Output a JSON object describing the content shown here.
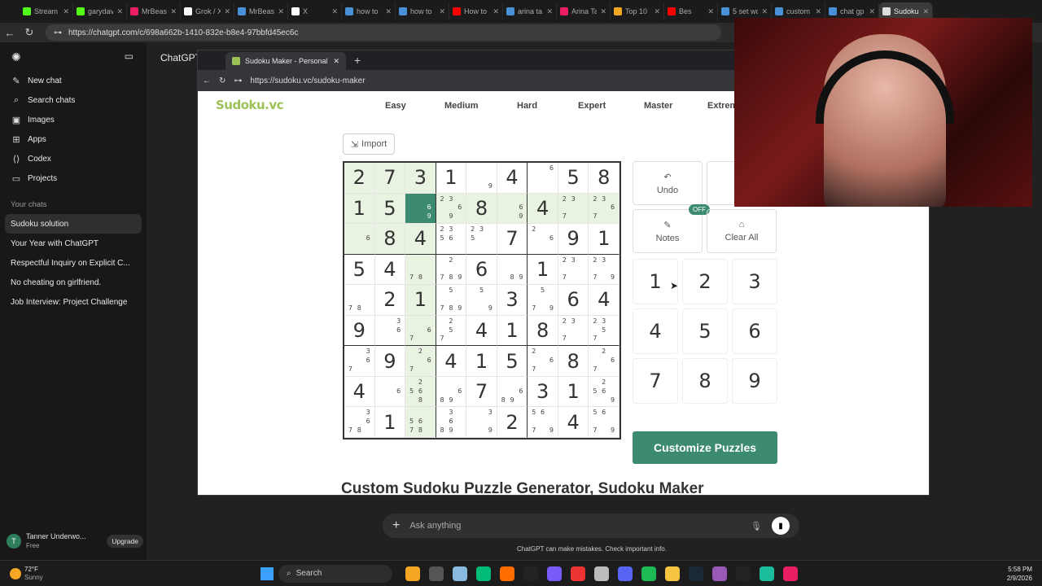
{
  "outer_browser": {
    "tabs": [
      {
        "label": "Stream",
        "color": "#53fc18"
      },
      {
        "label": "garydav",
        "color": "#53fc18"
      },
      {
        "label": "MrBeast",
        "color": "#e91e63"
      },
      {
        "label": "Grok / X",
        "color": "#ffffff"
      },
      {
        "label": "MrBeast",
        "color": "#4a90d9"
      },
      {
        "label": "X",
        "color": "#ffffff"
      },
      {
        "label": "how to",
        "color": "#4a90d9"
      },
      {
        "label": "how to",
        "color": "#4a90d9"
      },
      {
        "label": "How to",
        "color": "#ff0000"
      },
      {
        "label": "arina ta",
        "color": "#4a90d9"
      },
      {
        "label": "Arina Ta",
        "color": "#e91e63"
      },
      {
        "label": "Top 10",
        "color": "#f5a623"
      },
      {
        "label": "Bes",
        "color": "#ff0000"
      },
      {
        "label": "5 set wo",
        "color": "#4a90d9"
      },
      {
        "label": "custom",
        "color": "#4a90d9"
      },
      {
        "label": "chat gp",
        "color": "#4a90d9"
      },
      {
        "label": "Sudoku",
        "color": "#dddddd"
      }
    ],
    "url": "https://chatgpt.com/c/698a662b-1410-832e-b8e4-97bbfd45ec6c"
  },
  "chatgpt": {
    "header_title": "ChatGPT",
    "nav": [
      {
        "label": "New chat",
        "icon": "pencil-icon"
      },
      {
        "label": "Search chats",
        "icon": "search-icon"
      },
      {
        "label": "Images",
        "icon": "image-icon"
      },
      {
        "label": "Apps",
        "icon": "apps-icon"
      },
      {
        "label": "Codex",
        "icon": "code-icon"
      },
      {
        "label": "Projects",
        "icon": "folder-icon"
      }
    ],
    "chats_heading": "Your chats",
    "chats": [
      "Sudoku solution",
      "Your Year with ChatGPT",
      "Respectful Inquiry on Explicit C...",
      "No cheating on girlfriend.",
      "Job Interview: Project Challenge"
    ],
    "user_name": "Tanner Underwo...",
    "user_plan": "Free",
    "user_initial": "T",
    "upgrade_label": "Upgrade",
    "composer_placeholder": "Ask anything",
    "disclaimer": "ChatGPT can make mistakes. Check important info."
  },
  "inner_browser": {
    "tab_title": "Sudoku Maker - Personalized Puzz",
    "url": "https://sudoku.vc/sudoku-maker"
  },
  "sudoku_site": {
    "logo": "Sudoku.vc",
    "nav": [
      "Easy",
      "Medium",
      "Hard",
      "Expert",
      "Master",
      "Extrem"
    ],
    "import_label": "Import",
    "controls": {
      "undo": "Undo",
      "notes": "Notes",
      "notes_state": "OFF",
      "clear_all": "Clear All"
    },
    "keypad": [
      "1",
      "2",
      "3",
      "4",
      "5",
      "6",
      "7",
      "8",
      "9"
    ],
    "customize_label": "Customize Puzzles",
    "heading": "Custom Sudoku Puzzle Generator, Sudoku Maker",
    "grid": [
      [
        "2",
        "7",
        "3",
        "1",
        {
          "n": [
            "",
            "",
            "",
            "",
            "",
            "",
            "",
            "",
            "9"
          ]
        },
        "4",
        {
          "n": [
            "",
            "",
            "6",
            "",
            "",
            "",
            "",
            "",
            ""
          ]
        },
        "5",
        "8"
      ],
      [
        "1",
        "5",
        {
          "n": [
            "",
            "",
            "",
            "",
            "",
            "6",
            "",
            "",
            "9"
          ]
        },
        {
          "n": [
            "2",
            "3",
            "",
            "",
            "",
            "6",
            "",
            "9",
            ""
          ]
        },
        "8",
        {
          "n": [
            "",
            "",
            "",
            "",
            "",
            "6",
            "",
            "",
            "9"
          ]
        },
        "4",
        {
          "n": [
            "2",
            "3",
            "",
            "",
            "",
            "",
            "7",
            "",
            ""
          ]
        },
        {
          "n": [
            "2",
            "3",
            "",
            "",
            "",
            "6",
            "7",
            "",
            ""
          ]
        }
      ],
      [
        {
          "n": [
            "",
            "",
            "",
            "",
            "",
            "6",
            "",
            "",
            ""
          ]
        },
        "8",
        "4",
        {
          "n": [
            "2",
            "3",
            "",
            "5",
            "6",
            "",
            "",
            "",
            ""
          ]
        },
        {
          "n": [
            "2",
            "3",
            "",
            "5",
            "",
            "",
            "",
            "",
            ""
          ]
        },
        "7",
        {
          "n": [
            "2",
            "",
            "",
            "",
            "",
            "6",
            "",
            "",
            ""
          ]
        },
        "9",
        "1"
      ],
      [
        "5",
        "4",
        {
          "n": [
            "",
            "",
            "",
            "",
            "",
            "",
            "7",
            "8",
            ""
          ]
        },
        {
          "n": [
            "",
            "2",
            "",
            "",
            "",
            "",
            "7",
            "8",
            "9"
          ]
        },
        "6",
        {
          "n": [
            "",
            "",
            "",
            "",
            "",
            "",
            "",
            "8",
            "9"
          ]
        },
        "1",
        {
          "n": [
            "2",
            "3",
            "",
            "",
            "",
            "",
            "7",
            "",
            ""
          ]
        },
        {
          "n": [
            "2",
            "3",
            "",
            "",
            "",
            "",
            "7",
            "",
            "9"
          ]
        }
      ],
      [
        {
          "n": [
            "",
            "",
            "",
            "",
            "",
            "",
            "7",
            "8",
            ""
          ]
        },
        "2",
        "1",
        {
          "n": [
            "",
            "5",
            "",
            "",
            "",
            "",
            "7",
            "8",
            "9"
          ]
        },
        {
          "n": [
            "",
            "5",
            "",
            "",
            "",
            "",
            "",
            "",
            "9"
          ]
        },
        "3",
        {
          "n": [
            "",
            "5",
            "",
            "",
            "",
            "",
            "7",
            "",
            "9"
          ]
        },
        "6",
        "4"
      ],
      [
        "9",
        {
          "n": [
            "",
            "",
            "3",
            "",
            "",
            "6",
            "",
            "",
            ""
          ]
        },
        {
          "n": [
            "",
            "",
            "",
            "",
            "",
            "6",
            "7",
            "",
            ""
          ]
        },
        {
          "n": [
            "",
            "2",
            "",
            "",
            "5",
            "",
            "7",
            "",
            ""
          ]
        },
        "4",
        "1",
        "8",
        {
          "n": [
            "2",
            "3",
            "",
            "",
            "",
            "",
            "7",
            "",
            ""
          ]
        },
        {
          "n": [
            "2",
            "3",
            "",
            "",
            "5",
            "",
            "7",
            "",
            ""
          ]
        }
      ],
      [
        {
          "n": [
            "",
            "",
            "3",
            "",
            "",
            "6",
            "7",
            "",
            ""
          ]
        },
        "9",
        {
          "n": [
            "",
            "2",
            "",
            "",
            "",
            "6",
            "7",
            "",
            ""
          ]
        },
        "4",
        "1",
        "5",
        {
          "n": [
            "2",
            "",
            "",
            "",
            "",
            "6",
            "7",
            "",
            ""
          ]
        },
        "8",
        {
          "n": [
            "",
            "2",
            "",
            "",
            "",
            "6",
            "7",
            "",
            ""
          ]
        }
      ],
      [
        "4",
        {
          "n": [
            "",
            "",
            "",
            "",
            "",
            "6",
            "",
            "",
            ""
          ]
        },
        {
          "n": [
            "",
            "2",
            "",
            "5",
            "6",
            "",
            "",
            "8",
            ""
          ]
        },
        {
          "n": [
            "",
            "",
            "",
            "",
            "",
            "6",
            "8",
            "9",
            ""
          ]
        },
        "7",
        {
          "n": [
            "",
            "",
            "",
            "",
            "",
            "6",
            "8",
            "9",
            ""
          ]
        },
        "3",
        "1",
        {
          "n": [
            "",
            "2",
            "",
            "5",
            "6",
            "",
            "",
            "",
            "9"
          ]
        }
      ],
      [
        {
          "n": [
            "",
            "",
            "3",
            "",
            "",
            "6",
            "7",
            "8",
            ""
          ]
        },
        "1",
        {
          "n": [
            "",
            "",
            "",
            "5",
            "6",
            "",
            "7",
            "8",
            ""
          ]
        },
        {
          "n": [
            "",
            "3",
            "",
            "",
            "6",
            "",
            "8",
            "9",
            ""
          ]
        },
        {
          "n": [
            "",
            "",
            "3",
            "",
            "",
            "",
            "",
            "",
            "9"
          ]
        },
        "2",
        {
          "n": [
            "5",
            "6",
            "",
            "",
            "",
            "",
            "7",
            "",
            "9"
          ]
        },
        "4",
        {
          "n": [
            "5",
            "6",
            "",
            "",
            "",
            "",
            "7",
            "",
            "9"
          ]
        }
      ]
    ]
  },
  "taskbar": {
    "weather_temp": "72°F",
    "weather_desc": "Sunny",
    "search_label": "Search",
    "time": "5:58 PM",
    "date": "2/9/2026"
  }
}
